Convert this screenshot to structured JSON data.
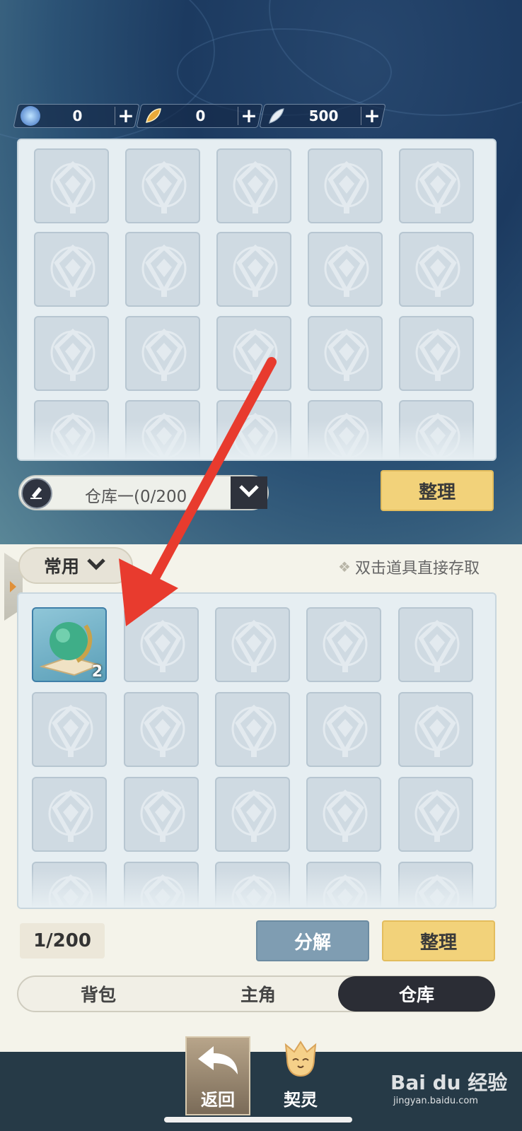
{
  "currency": [
    {
      "icon": "blue-orb-icon",
      "value": "0",
      "plus": "+"
    },
    {
      "icon": "gold-leaf-icon",
      "value": "0",
      "plus": "+"
    },
    {
      "icon": "silver-feather-icon",
      "value": "500",
      "plus": "+"
    }
  ],
  "warehouse": {
    "selector_label": "仓库一(0/200",
    "sort_label": "整理"
  },
  "bag": {
    "filter_label": "常用",
    "hint": "双击道具直接存取",
    "item_count": "2",
    "capacity": "1/200",
    "decompose_label": "分解",
    "sort_label": "整理"
  },
  "tabs": [
    {
      "label": "背包"
    },
    {
      "label": "主角"
    },
    {
      "label": "仓库"
    }
  ],
  "nav": {
    "back_label": "返回",
    "spirit_label": "契灵"
  },
  "watermark": {
    "text": "Bai du 经验",
    "url": "jingyan.baidu.com"
  },
  "colors": {
    "accent_yellow": "#f2d27a",
    "active_tab": "#2b2d35",
    "arrow": "#e83b2e"
  }
}
